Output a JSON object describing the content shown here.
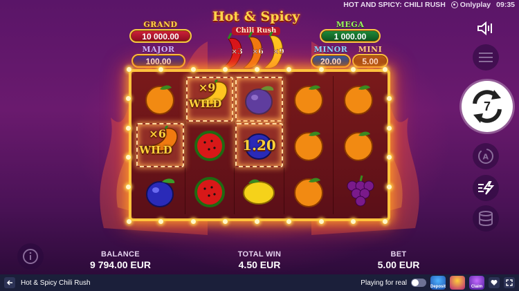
{
  "status_bar": {
    "game_title": "HOT AND SPICY: CHILI RUSH",
    "brand": "Onlyplay",
    "time": "09:35"
  },
  "logo": {
    "title": "Hot & Spicy",
    "subtitle": "Chili Rush",
    "multipliers": [
      "×3",
      "×6",
      "×9"
    ]
  },
  "jackpots": {
    "grand": {
      "label": "GRAND",
      "value": "10 000.00"
    },
    "major": {
      "label": "MAJOR",
      "value": "100.00"
    },
    "mega": {
      "label": "MEGA",
      "value": "1 000.00"
    },
    "minor": {
      "label": "MINOR",
      "value": "20.00"
    },
    "mini": {
      "label": "MINI",
      "value": "5.00"
    }
  },
  "reels": {
    "symbols": [
      [
        "orange",
        "wild",
        "plum",
        "orange",
        "orange"
      ],
      [
        "wild",
        "watermelon",
        "cash",
        "orange",
        "orange"
      ],
      [
        "plum",
        "watermelon",
        "lemon",
        "orange",
        "grapes"
      ]
    ],
    "highlighted_cells": [
      [
        0,
        1
      ],
      [
        0,
        2
      ],
      [
        1,
        0
      ],
      [
        1,
        2
      ]
    ],
    "wild_top": {
      "multiplier": "×9",
      "label": "WILD"
    },
    "wild_left": {
      "multiplier": "×6",
      "label": "WILD"
    },
    "cash_value": "1.20"
  },
  "controls": {
    "spins_remaining": "7",
    "icons": [
      "sound-icon",
      "menu-icon",
      "spin-icon",
      "autoplay-icon",
      "turbo-icon",
      "bet-stack-icon",
      "info-icon"
    ]
  },
  "stats": {
    "balance_label": "BALANCE",
    "balance_value": "9 794.00 EUR",
    "win_label": "TOTAL WIN",
    "win_value": "4.50 EUR",
    "bet_label": "BET",
    "bet_value": "5.00 EUR"
  },
  "footer": {
    "game_name": "Hot & Spicy Chili Rush",
    "real_mode_label": "Playing for real",
    "promos": [
      "Deposit",
      "",
      "Claim"
    ]
  },
  "colors": {
    "background": "#5a1568",
    "frame_gold": "#ffc23d",
    "footer": "#1b1f3a"
  }
}
